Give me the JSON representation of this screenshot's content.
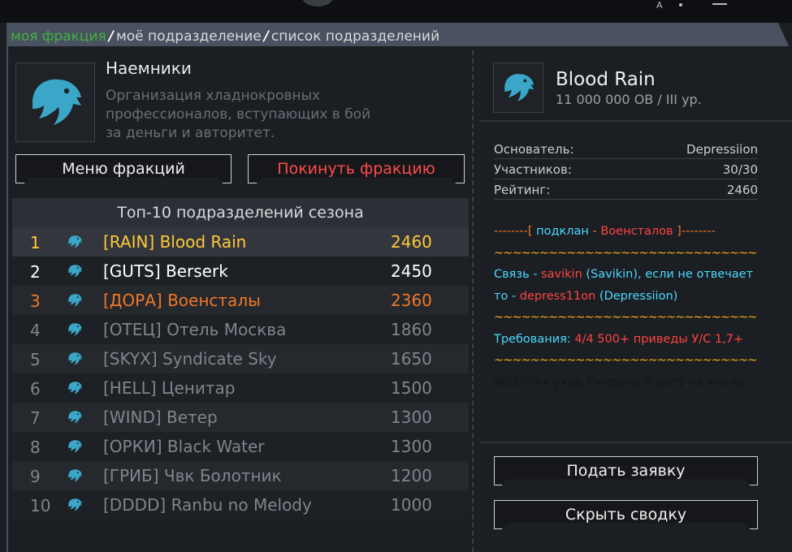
{
  "breadcrumb": {
    "items": [
      "моя фракция",
      "моё подразделение",
      "список подразделений"
    ],
    "separator": "/"
  },
  "faction": {
    "name": "Наемники",
    "description": "Организация хладнокровных профессионалов, вступающих в бой за деньги и авторитет.",
    "menu_button": "Меню фракций",
    "leave_button": "Покинуть фракцию"
  },
  "top_list": {
    "title": "Топ-10 подразделений сезона",
    "rows": [
      {
        "rank": "1",
        "name": "[RAIN] Blood Rain",
        "score": "2460",
        "color": "#ffc838"
      },
      {
        "rank": "2",
        "name": "[GUTS] Berserk",
        "score": "2450",
        "color": "#ffffff"
      },
      {
        "rank": "3",
        "name": "[ДОРА] Военсталы",
        "score": "2360",
        "color": "#f07828"
      },
      {
        "rank": "4",
        "name": "[ОТЕЦ] Отель Москва",
        "score": "1860",
        "color": "#80858c"
      },
      {
        "rank": "5",
        "name": "[SKYX] Syndicate Sky",
        "score": "1650",
        "color": "#80858c"
      },
      {
        "rank": "6",
        "name": "[HELL] Ценитар",
        "score": "1500",
        "color": "#80858c"
      },
      {
        "rank": "7",
        "name": "[WIND] Ветер",
        "score": "1300",
        "color": "#80858c"
      },
      {
        "rank": "8",
        "name": "[ОРКИ] Black Water",
        "score": "1300",
        "color": "#80858c"
      },
      {
        "rank": "9",
        "name": "[ГРИБ] Чвк Болотник",
        "score": "1200",
        "color": "#80858c"
      },
      {
        "rank": "10",
        "name": "[DDDD] Ranbu no Melody",
        "score": "1000",
        "color": "#80858c"
      }
    ]
  },
  "division": {
    "name": "Blood Rain",
    "subtitle": "11 000 000 ОВ / III ур.",
    "founder_label": "Основатель:",
    "founder_value": "Depressiion",
    "members_label": "Участников:",
    "members_value": "30/30",
    "rating_label": "Рейтинг:",
    "rating_value": "2460",
    "notes": {
      "l1a": "--------[ ",
      "l1b": "подклан",
      "l1c": " - ",
      "l1d": "Военсталов",
      "l1e": " ]--------",
      "wave": "~~~~~~~~~~~~~~~~~~~~~~~~~~~~~",
      "l3a": "Связь",
      "l3b": " - ",
      "l3c": "savikin",
      "l3d": " (Savikin), если не отвечает",
      "l4a": "то",
      "l4b": " - ",
      "l4c": "depress11on",
      "l4d": " (Depressiion)",
      "l6a": "Требования: ",
      "l6b": "4/4 500+ приведы У/С 1,7+",
      "l8": "90/100кк уход Кмирана в доту на месяц"
    },
    "apply_button": "Подать заявку",
    "hide_button": "Скрыть сводку"
  },
  "colors": {
    "accent_green": "#3fb23f",
    "leave_red": "#ff4a4a",
    "eagle_blue": "#3aa6c8"
  },
  "icons": {
    "faction_logo": "eagle-icon",
    "row_icon": "eagle-icon"
  }
}
